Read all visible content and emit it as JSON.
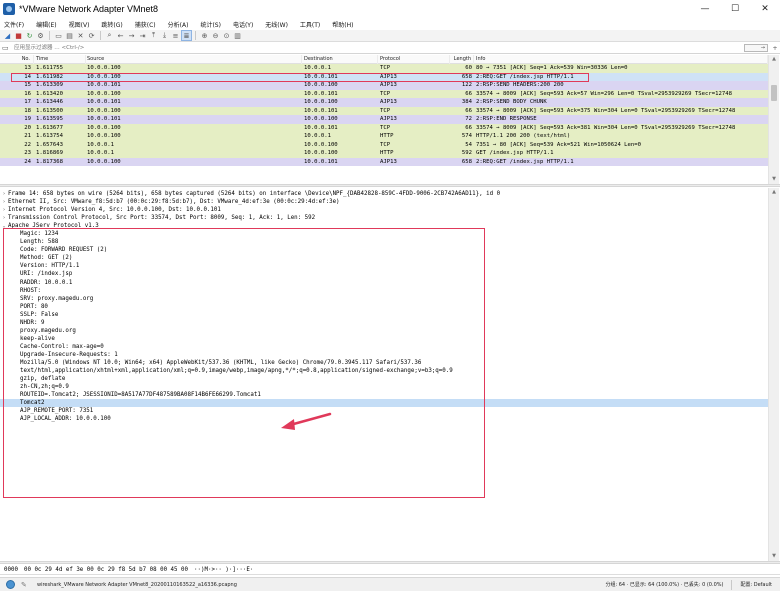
{
  "window": {
    "title": "*VMware Network Adapter VMnet8",
    "minimize": "—",
    "maximize": "☐",
    "close": "✕"
  },
  "menu": [
    "文件(F)",
    "编辑(E)",
    "视图(V)",
    "跳转(G)",
    "捕获(C)",
    "分析(A)",
    "统计(S)",
    "电话(Y)",
    "无线(W)",
    "工具(T)",
    "帮助(H)"
  ],
  "filter": {
    "placeholder": "应用显示过滤器 … <Ctrl-/>",
    "arrow": "→",
    "expression_button": "+"
  },
  "packet_list": {
    "columns": [
      "No.",
      "Time",
      "Source",
      "Destination",
      "Protocol",
      "Length",
      "Info"
    ],
    "rows": [
      {
        "no": "13",
        "time": "1.611755",
        "src": "10.0.0.100",
        "dst": "10.0.0.1",
        "proto": "TCP",
        "len": "60",
        "info": "80 → 7351 [ACK] Seq=1 Ack=539 Win=30336 Len=0",
        "kind": "tcp"
      },
      {
        "no": "14",
        "time": "1.611982",
        "src": "10.0.0.100",
        "dst": "10.0.0.101",
        "proto": "AJP13",
        "len": "658",
        "info": "2:REQ:GET /index.jsp HTTP/1.1",
        "kind": "sel"
      },
      {
        "no": "15",
        "time": "1.613309",
        "src": "10.0.0.101",
        "dst": "10.0.0.100",
        "proto": "AJP13",
        "len": "122",
        "info": "2:RSP:SEND HEADERS:200 200",
        "kind": "ajp"
      },
      {
        "no": "16",
        "time": "1.613420",
        "src": "10.0.0.100",
        "dst": "10.0.0.101",
        "proto": "TCP",
        "len": "66",
        "info": "33574 → 8009 [ACK] Seq=593 Ack=57 Win=296 Len=0 TSval=2953929269 TSecr=12748",
        "kind": "tcp"
      },
      {
        "no": "17",
        "time": "1.613446",
        "src": "10.0.0.101",
        "dst": "10.0.0.100",
        "proto": "AJP13",
        "len": "384",
        "info": "2:RSP:SEND BODY CHUNK",
        "kind": "ajp"
      },
      {
        "no": "18",
        "time": "1.613500",
        "src": "10.0.0.100",
        "dst": "10.0.0.101",
        "proto": "TCP",
        "len": "66",
        "info": "33574 → 8009 [ACK] Seq=593 Ack=375 Win=304 Len=0 TSval=2953929269 TSecr=12748",
        "kind": "tcp"
      },
      {
        "no": "19",
        "time": "1.613595",
        "src": "10.0.0.101",
        "dst": "10.0.0.100",
        "proto": "AJP13",
        "len": "72",
        "info": "2:RSP:END RESPONSE",
        "kind": "ajp"
      },
      {
        "no": "20",
        "time": "1.613677",
        "src": "10.0.0.100",
        "dst": "10.0.0.101",
        "proto": "TCP",
        "len": "66",
        "info": "33574 → 8009 [ACK] Seq=593 Ack=381 Win=304 Len=0 TSval=2953929269 TSecr=12748",
        "kind": "tcp"
      },
      {
        "no": "21",
        "time": "1.613754",
        "src": "10.0.0.100",
        "dst": "10.0.0.1",
        "proto": "HTTP",
        "len": "574",
        "info": "HTTP/1.1 200 200  (text/html)",
        "kind": "http"
      },
      {
        "no": "22",
        "time": "1.657643",
        "src": "10.0.0.1",
        "dst": "10.0.0.100",
        "proto": "TCP",
        "len": "54",
        "info": "7351 → 80 [ACK] Seq=539 Ack=521 Win=1050624 Len=0",
        "kind": "tcp"
      },
      {
        "no": "23",
        "time": "1.816869",
        "src": "10.0.0.1",
        "dst": "10.0.0.100",
        "proto": "HTTP",
        "len": "592",
        "info": "GET /index.jsp HTTP/1.1",
        "kind": "http"
      },
      {
        "no": "24",
        "time": "1.817368",
        "src": "10.0.0.100",
        "dst": "10.0.0.101",
        "proto": "AJP13",
        "len": "658",
        "info": "2:REQ:GET /index.jsp HTTP/1.1",
        "kind": "ajp"
      }
    ]
  },
  "details": {
    "top": [
      "Frame 14: 658 bytes on wire (5264 bits), 658 bytes captured (5264 bits) on interface \\Device\\NPF_{DAB42828-859C-4FDD-9006-2CB742A6AD11}, id 0",
      "Ethernet II, Src: VMware_f8:5d:b7 (00:0c:29:f8:5d:b7), Dst: VMware_4d:ef:3e (00:0c:29:4d:ef:3e)",
      "Internet Protocol Version 4, Src: 10.0.0.100, Dst: 10.0.0.101",
      "Transmission Control Protocol, Src Port: 33574, Dst Port: 8009, Seq: 1, Ack: 1, Len: 592",
      "Apache JServ Protocol v1.3"
    ],
    "ajp": [
      "Magic: 1234",
      "Length: 588",
      "Code: FORWARD REQUEST (2)",
      "Method: GET (2)",
      "Version: HTTP/1.1",
      "URI: /index.jsp",
      "RADDR: 10.0.0.1",
      "RHOST:",
      "SRV: proxy.magedu.org",
      "PORT: 80",
      "SSLP: False",
      "NHDR: 9",
      "proxy.magedu.org",
      "keep-alive",
      "Cache-Control: max-age=0",
      "Upgrade-Insecure-Requests: 1",
      "Mozilla/5.0 (Windows NT 10.0; Win64; x64) AppleWebKit/537.36 (KHTML, like Gecko) Chrome/79.0.3945.117 Safari/537.36",
      "text/html,application/xhtml+xml,application/xml;q=0.9,image/webp,image/apng,*/*;q=0.8,application/signed-exchange;v=b3;q=0.9",
      "gzip, deflate",
      "zh-CN,zh;q=0.9",
      "ROUTEID=.Tomcat2; JSESSIONID=8A517A77DF487589BA08F14B6FE66299.Tomcat1",
      "Tomcat2",
      "AJP_REMOTE_PORT: 7351",
      "AJP_LOCAL_ADDR: 10.0.0.100"
    ]
  },
  "bytes": {
    "offset": "0000",
    "hex": "00 0c 29 4d ef 3e 00 0c  29 f8 5d b7 08 00 45 00",
    "ascii": "··)M·>·· )·]···E·"
  },
  "status": {
    "file": "wireshark_VMware Network Adapter VMnet8_20200110163522_a16336.pcapng",
    "stats": "分组: 64 · 已显示: 64 (100.0%) · 已丢失: 0 (0.0%)",
    "profile": "配置: Default"
  },
  "colors": {
    "tcp_row": "#e5eec4",
    "ajp_row": "#dad5f2",
    "selected_row": "#cfe2f6",
    "annotation": "#e0395a"
  }
}
